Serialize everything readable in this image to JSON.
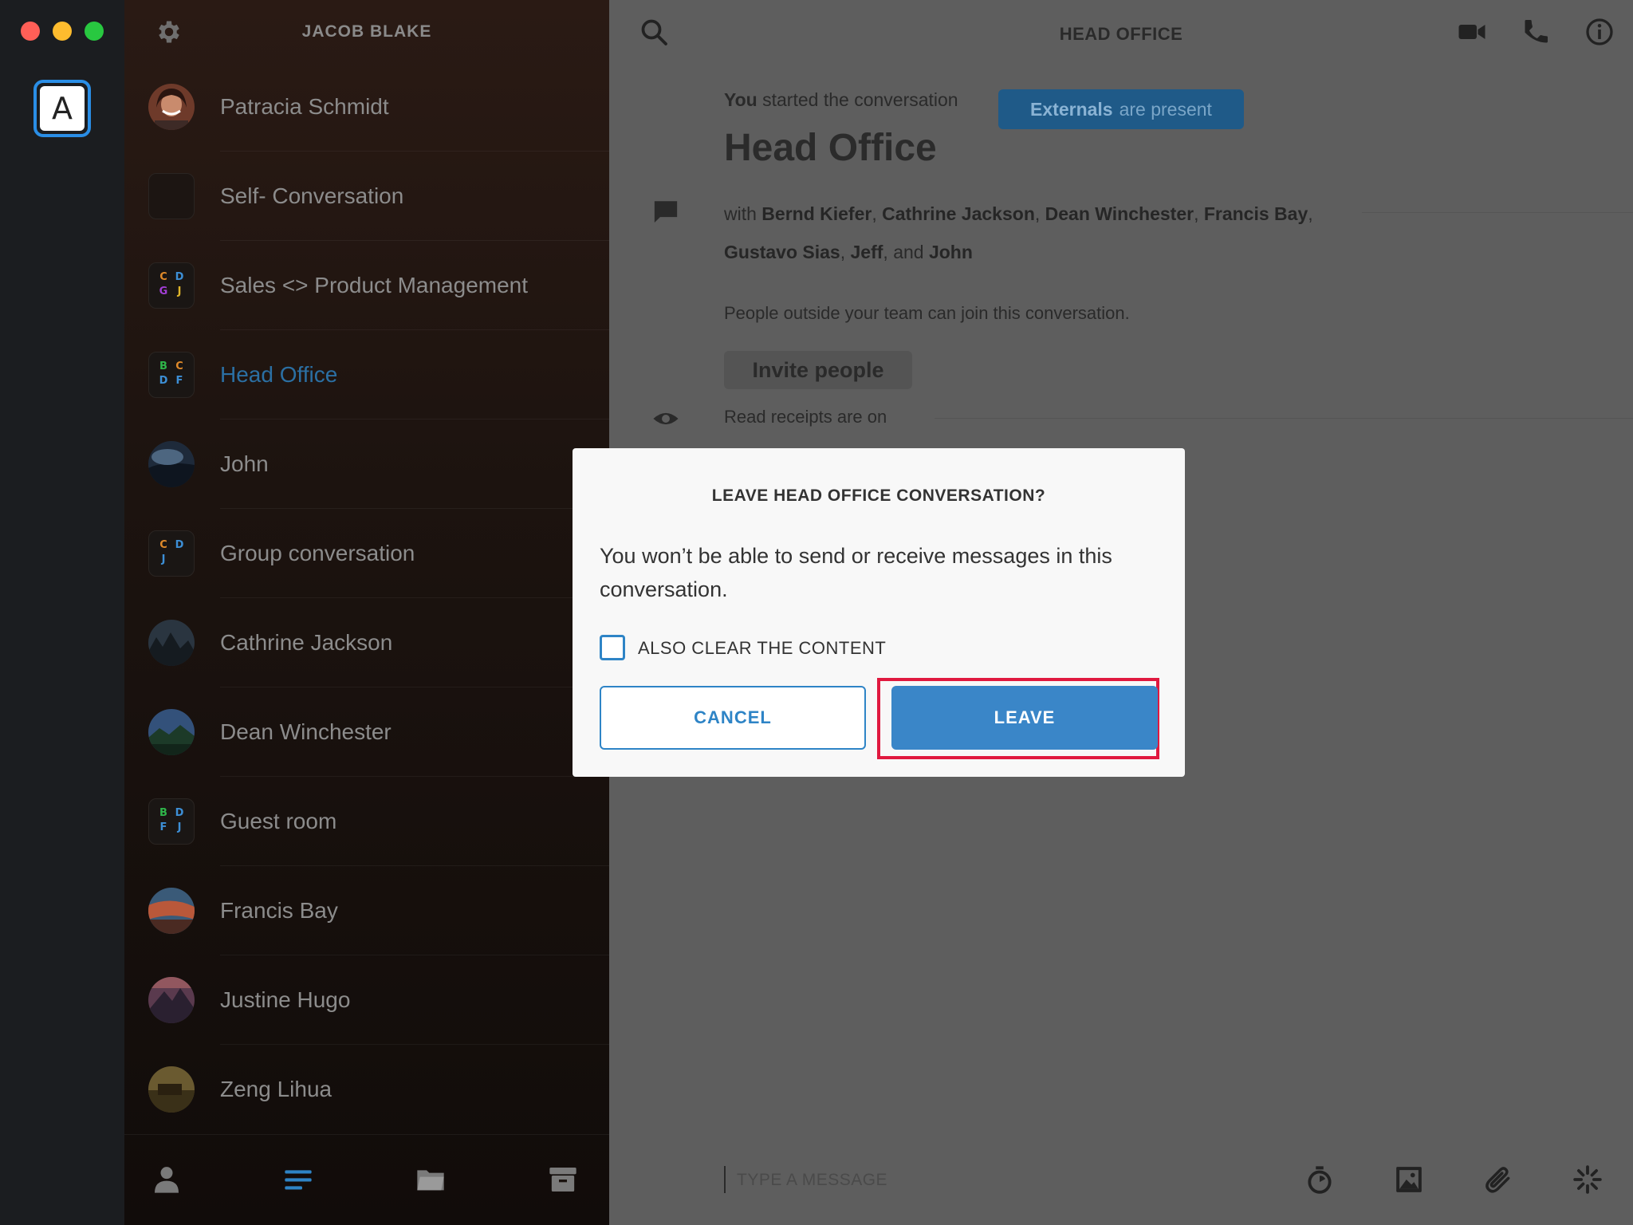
{
  "account": {
    "initial": "A"
  },
  "sidebar": {
    "user_name": "JACOB BLAKE",
    "conversations": [
      {
        "name": "Patracia Schmidt",
        "active": false
      },
      {
        "name": "Self- Conversation",
        "active": false
      },
      {
        "name": "Sales <> Product Management",
        "active": false,
        "initials": [
          "C",
          "D",
          "G",
          "J"
        ]
      },
      {
        "name": "Head Office",
        "active": true,
        "initials": [
          "B",
          "C",
          "D",
          "F"
        ]
      },
      {
        "name": "John",
        "active": false
      },
      {
        "name": "Group conversation",
        "active": false,
        "initials": [
          "C",
          "D",
          "J",
          ""
        ]
      },
      {
        "name": "Cathrine Jackson",
        "active": false
      },
      {
        "name": "Dean Winchester",
        "active": false
      },
      {
        "name": "Guest room",
        "active": false,
        "initials": [
          "B",
          "D",
          "F",
          "J"
        ]
      },
      {
        "name": "Francis Bay",
        "active": false
      },
      {
        "name": "Justine Hugo",
        "active": false
      },
      {
        "name": "Zeng Lihua",
        "active": false
      }
    ],
    "footer_icons": [
      "person-icon",
      "conversations-icon",
      "folder-icon",
      "archive-icon"
    ]
  },
  "main": {
    "title": "HEAD OFFICE",
    "started_by": "You",
    "started_text": "started the conversation",
    "externals_badge": {
      "bold": "Externals",
      "rest": "are present"
    },
    "conversation_name": "Head Office",
    "with_prefix": "with",
    "participants": [
      "Bernd Kiefer",
      "Cathrine Jackson",
      "Dean Winchester",
      "Francis Bay",
      "Gustavo Sias",
      "Jeff",
      "John"
    ],
    "and_word": "and",
    "outside_note": "People outside your team can join this conversation.",
    "invite_label": "Invite people",
    "read_receipts": "Read receipts are on",
    "compose_placeholder": "TYPE A MESSAGE"
  },
  "modal": {
    "title": "LEAVE HEAD OFFICE CONVERSATION?",
    "body": "You won’t be able to send or receive messages in this conversation.",
    "checkbox_label": "ALSO CLEAR THE CONTENT",
    "checkbox_checked": false,
    "cancel_label": "CANCEL",
    "leave_label": "LEAVE"
  },
  "colors": {
    "accent": "#2e84c6",
    "leave": "#3a86c8",
    "highlight": "#e0193f",
    "active_conversation": "#2b6fa3"
  }
}
